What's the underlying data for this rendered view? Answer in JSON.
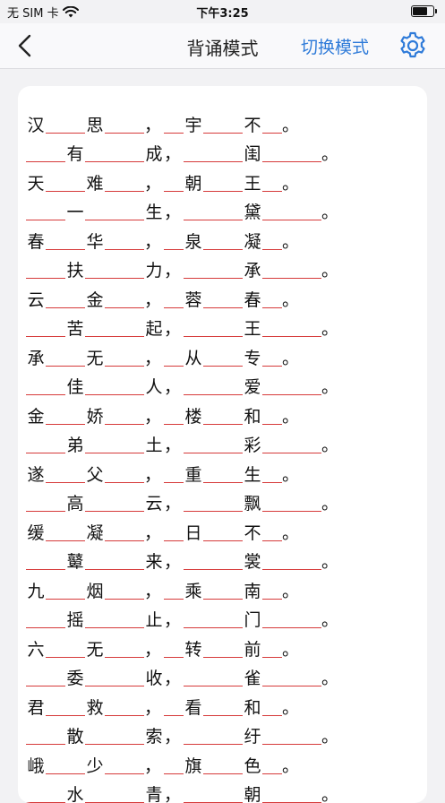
{
  "status_bar": {
    "carrier": "无 SIM 卡",
    "time": "下午3:25",
    "battery_level": 0.75
  },
  "nav": {
    "title": "背诵模式",
    "switch_label": "切换模式"
  },
  "lines": [
    [
      "汉",
      "_",
      "思",
      "_",
      "，",
      "_",
      "宇",
      "_",
      "不",
      "_",
      "。"
    ],
    [
      "_",
      "有",
      "_",
      "成",
      "，",
      "_",
      "闺",
      "_",
      "。"
    ],
    [
      "天",
      "_",
      "难",
      "_",
      "，",
      "_",
      "朝",
      "_",
      "王",
      "_",
      "。"
    ],
    [
      "_",
      "一",
      "_",
      "生",
      "，",
      "_",
      "黛",
      "_",
      "。"
    ],
    [
      "春",
      "_",
      "华",
      "_",
      "，",
      "_",
      "泉",
      "_",
      "凝",
      "_",
      "。"
    ],
    [
      "_",
      "扶",
      "_",
      "力",
      "，",
      "_",
      "承",
      "_",
      "。"
    ],
    [
      "云",
      "_",
      "金",
      "_",
      "，",
      "_",
      "蓉",
      "_",
      "春",
      "_",
      "。"
    ],
    [
      "_",
      "苦",
      "_",
      "起",
      "，",
      "_",
      "王",
      "_",
      "。"
    ],
    [
      "承",
      "_",
      "无",
      "_",
      "，",
      "_",
      "从",
      "_",
      "专",
      "_",
      "。"
    ],
    [
      "_",
      "佳",
      "_",
      "人",
      "，",
      "_",
      "爱",
      "_",
      "。"
    ],
    [
      "金",
      "_",
      "娇",
      "_",
      "，",
      "_",
      "楼",
      "_",
      "和",
      "_",
      "。"
    ],
    [
      "_",
      "弟",
      "_",
      "土",
      "，",
      "_",
      "彩",
      "_",
      "。"
    ],
    [
      "遂",
      "_",
      "父",
      "_",
      "，",
      "_",
      "重",
      "_",
      "生",
      "_",
      "。"
    ],
    [
      "_",
      "高",
      "_",
      "云",
      "，",
      "_",
      "飘",
      "_",
      "。"
    ],
    [
      "缓",
      "_",
      "凝",
      "_",
      "，",
      "_",
      "日",
      "_",
      "不",
      "_",
      "。"
    ],
    [
      "_",
      "鼙",
      "_",
      "来",
      "，",
      "_",
      "裳",
      "_",
      "。"
    ],
    [
      "九",
      "_",
      "烟",
      "_",
      "，",
      "_",
      "乘",
      "_",
      "南",
      "_",
      "。"
    ],
    [
      "_",
      "摇",
      "_",
      "止",
      "，",
      "_",
      "门",
      "_",
      "。"
    ],
    [
      "六",
      "_",
      "无",
      "_",
      "，",
      "_",
      "转",
      "_",
      "前",
      "_",
      "。"
    ],
    [
      "_",
      "委",
      "_",
      "收",
      "，",
      "_",
      "雀",
      "_",
      "。"
    ],
    [
      "君",
      "_",
      "救",
      "_",
      "，",
      "_",
      "看",
      "_",
      "和",
      "_",
      "。"
    ],
    [
      "_",
      "散",
      "_",
      "索",
      "，",
      "_",
      "纡",
      "_",
      "。"
    ],
    [
      "峨",
      "_",
      "少",
      "_",
      "，",
      "_",
      "旗",
      "_",
      "色",
      "_",
      "。"
    ],
    [
      "_",
      "水",
      "_",
      "青",
      "，",
      "_",
      "朝",
      "_",
      "。"
    ]
  ]
}
